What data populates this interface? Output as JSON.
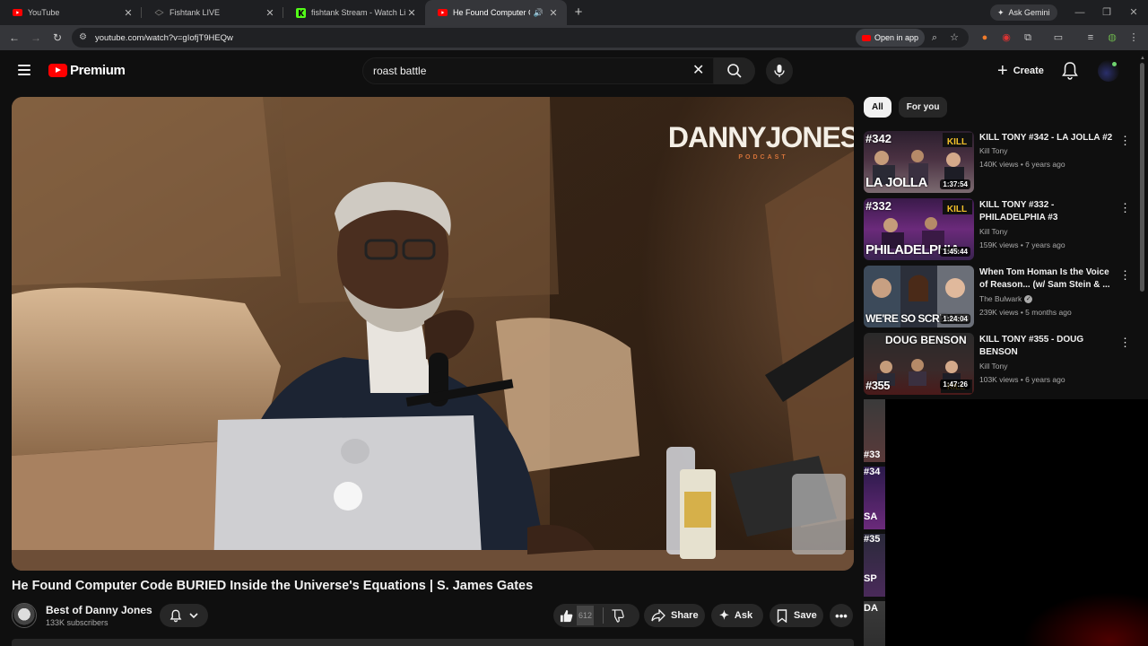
{
  "browser": {
    "tabs": [
      {
        "title": "YouTube",
        "icon": "youtube-icon",
        "active": false
      },
      {
        "title": "Fishtank LIVE",
        "icon": "fishtank-icon",
        "active": false
      },
      {
        "title": "fishtank Stream - Watch Live on",
        "icon": "kick-icon",
        "active": false
      },
      {
        "title": "He Found Computer Code |",
        "icon": "youtube-icon",
        "active": true
      }
    ],
    "ask_gemini": "Ask Gemini",
    "url": "youtube.com/watch?v=gIofjT9HEQw",
    "open_in_app": "Open in app"
  },
  "masthead": {
    "logo_text": "Premium",
    "search_value": "roast battle",
    "create_label": "Create"
  },
  "video": {
    "overlay_logo": "DANNYJONES",
    "overlay_sub": "PODCAST",
    "title": "He Found Computer Code BURIED Inside the Universe's Equations | S. James Gates",
    "channel": "Best of Danny Jones",
    "subscribers": "133K subscribers",
    "like_count": "612",
    "share_label": "Share",
    "ask_label": "Ask",
    "save_label": "Save"
  },
  "sidebar": {
    "chips": [
      {
        "label": "All",
        "active": true
      },
      {
        "label": "For you",
        "active": false
      }
    ],
    "recommendations": [
      {
        "title": "KILL TONY #342 - LA JOLLA #2",
        "channel": "Kill Tony",
        "views": "140K views • 6 years ago",
        "duration": "1:37:54",
        "thumb_ep": "#342",
        "thumb_text": "LA JOLLA",
        "verified": false
      },
      {
        "title": "KILL TONY #332 - PHILADELPHIA #3",
        "channel": "Kill Tony",
        "views": "159K views • 7 years ago",
        "duration": "1:45:44",
        "thumb_ep": "#332",
        "thumb_text": "PHILADELPHIA",
        "verified": false
      },
      {
        "title": "When Tom Homan Is the Voice of Reason... (w/ Sam Stein & ...",
        "channel": "The Bulwark",
        "views": "239K views • 5 months ago",
        "duration": "1:24:04",
        "thumb_ep": "",
        "thumb_text": "WE'RE SO SCREWED",
        "verified": true
      },
      {
        "title": "KILL TONY #355 - DOUG BENSON",
        "channel": "Kill Tony",
        "views": "103K views • 6 years ago",
        "duration": "1:47:26",
        "thumb_ep": "DOUG BENSON",
        "thumb_text": "#355",
        "verified": false
      }
    ],
    "mini_labels": [
      "#33",
      "#34",
      "SA",
      "#35",
      "SP",
      "DA"
    ]
  },
  "colors": {
    "background": "#0f0f0f",
    "brand_red": "#ff0000",
    "pill": "#272727",
    "text": "#f1f1f1",
    "muted": "#aaaaaa"
  }
}
